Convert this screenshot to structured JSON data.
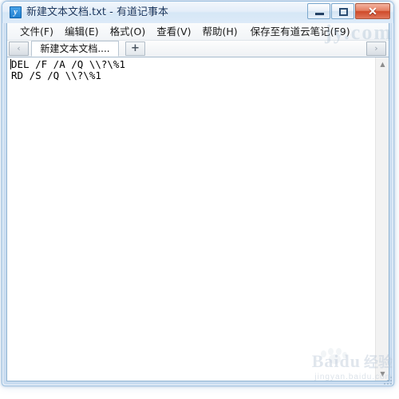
{
  "window": {
    "title": "新建文本文档.txt - 有道记事本",
    "icon": "youdao-note-icon",
    "icon_glyph": "y",
    "controls": {
      "minimize_label": "—",
      "maximize_label": "□",
      "close_label": "✕"
    }
  },
  "menu": {
    "items": [
      {
        "label": "文件(F)"
      },
      {
        "label": "编辑(E)"
      },
      {
        "label": "格式(O)"
      },
      {
        "label": "查看(V)"
      },
      {
        "label": "帮助(H)"
      },
      {
        "label": "保存至有道云笔记(F9)"
      }
    ]
  },
  "tabs": {
    "scroll_left_glyph": "‹",
    "scroll_right_glyph": "›",
    "add_label": "+",
    "items": [
      {
        "label": "新建文本文档....",
        "active": true
      }
    ]
  },
  "editor": {
    "lines": [
      "DEL /F /A /Q \\\\?\\%1",
      "RD /S /Q \\\\?\\%1"
    ],
    "text": "DEL /F /A /Q \\\\?\\%1\nRD /S /Q \\\\?\\%1"
  },
  "scrollbar": {
    "up_glyph": "▲",
    "down_glyph": "▼"
  },
  "watermarks": {
    "top_right": "jy.com",
    "bottom_logo": "Baidu",
    "bottom_cn": "经验",
    "bottom_url": "jingyan.baidu.com"
  },
  "colors": {
    "accent": "#1e7fd0",
    "close_button": "#cf4a29",
    "frame": "#9cc0e0",
    "text": "#000000"
  }
}
